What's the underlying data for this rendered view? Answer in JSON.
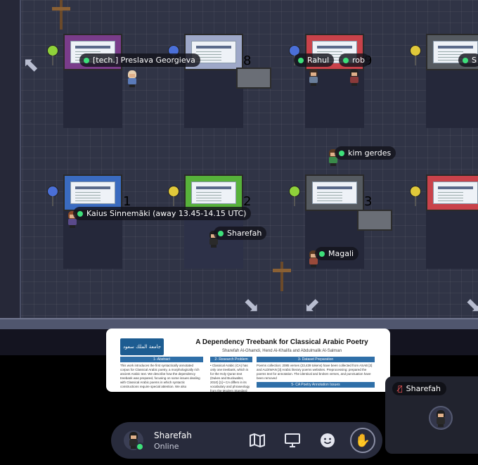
{
  "map": {
    "booth_numbers": [
      "8",
      "9",
      "1",
      "2",
      "3"
    ],
    "players": [
      {
        "name": "[tech.] Preslava Georgieva"
      },
      {
        "name": "Rahul"
      },
      {
        "name": "rob"
      },
      {
        "name": "S"
      },
      {
        "name": "kim gerdes"
      },
      {
        "name": "Kaius Sinnemäki (away 13.45-14.15 UTC)"
      },
      {
        "name": "Sharefah"
      },
      {
        "name": "Magali"
      }
    ]
  },
  "poster_preview": {
    "logo_text": "جامعة الملك سعود",
    "title": "A Dependency Treebank for Classical Arabic Poetry",
    "authors": "Sharefah Al-Ghamdi, Hend Al-Khalifa and Abdulmalik Al-Salman",
    "sections": [
      {
        "heading": "1- Abstract",
        "text": "This work introduces the first syntactically annotated corpus for Classical Arabic poetry, a morphologically rich ancient Arabic text. We describe how the dependency treebank was prepared, focusing on some issues dealing with Classical Arabic poems in which syntactic constructions require special attention. We also"
      },
      {
        "heading": "2- Research Problem",
        "text": "• Classical Arabic (CA) has only one treebank, which is for the Holy Quran text (Dukes and Buckwalter, 2010) [1] • CA differs in its vocabulary and phraseology from the Modern Standard Arabic (MSA) • To maintain the rhyme and rhythm of"
      },
      {
        "heading": "3- Dataset Preparation",
        "text": "Poems collection: 2085 verses (23,439 tokens) have been collected from ASAB [2] and ALDIWAN [3] Arabic literary poems websites. Preprocessing: prepared the poems text for annotation. The identical and broken verses, and punctuation have been removed"
      },
      {
        "heading": "5- CA Poetry Annotation Issues",
        "text": ""
      }
    ]
  },
  "camera": {
    "name": "Sharefah"
  },
  "bottom_bar": {
    "name": "Sharefah",
    "status": "Online"
  },
  "colors": {
    "online": "#3ee07a",
    "bar_bg": "#282b3c",
    "mic_off": "#ff5a5a"
  }
}
